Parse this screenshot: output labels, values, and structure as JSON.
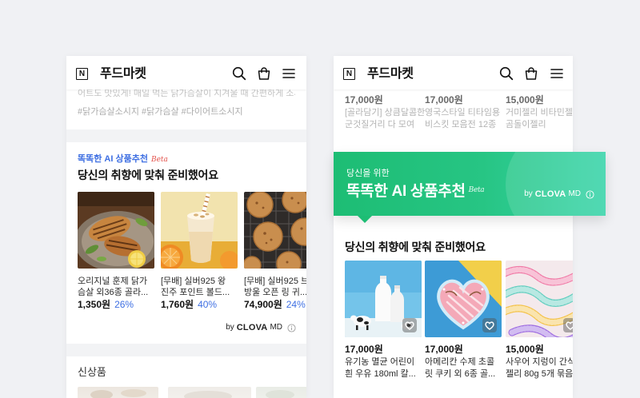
{
  "colors": {
    "page_background": "#f0f1f4",
    "ai_blue": "#3e6fe2",
    "beta_red": "#e3524b",
    "banner_green_start": "#1dbd74",
    "banner_green_end": "#38d4a9"
  },
  "left_screen": {
    "header": {
      "logo": "N",
      "title": "푸드마켓",
      "icons": [
        "search-icon",
        "shopping-bag-icon",
        "menu-icon"
      ]
    },
    "previous_product": {
      "description": "어트도 맛있게! 매일 먹는 닭가슴살이 지겨울 때 간편하게 소시",
      "hashtags": "#닭가슴살소시지 #닭가슴살 #다이어트소시지"
    },
    "recommendation": {
      "eyebrow": "똑똑한 AI 상품추천",
      "beta": "Beta",
      "title": "당신의 취향에 맞춰 준비했어요",
      "products": [
        {
          "image": "grilled-chicken-photo",
          "name_lines": [
            "오리지널 훈제 닭가",
            "슴살 외36종 골라..."
          ],
          "price": "1,350원",
          "discount": "26%"
        },
        {
          "image": "orange-smoothie-photo",
          "name_lines": [
            "[무배] 실버925 왕",
            "진주 포인트 볼드..."
          ],
          "price": "1,760원",
          "discount": "40%"
        },
        {
          "image": "cookies-photo",
          "name_lines": [
            "[무배] 실버925 브",
            "방울 오픈 링 귀..."
          ],
          "price": "74,900원",
          "discount": "24%"
        }
      ],
      "credit": {
        "by": "by",
        "brand": "CLOVA",
        "suffix": "MD",
        "icon": "info-icon"
      }
    },
    "new_arrivals": {
      "title": "신상품"
    }
  },
  "right_screen": {
    "header": {
      "logo": "N",
      "title": "푸드마켓",
      "icons": [
        "search-icon",
        "shopping-bag-icon",
        "menu-icon"
      ]
    },
    "previous_row": [
      {
        "price": "17,000원",
        "name_lines": [
          "[골라담기] 상큼달콤한",
          "군것질거리 다 모여"
        ]
      },
      {
        "price": "17,000원",
        "name_lines": [
          "영국스타일 티타임용",
          "비스킷 모음전 12종"
        ]
      },
      {
        "price": "15,000원",
        "name_lines": [
          "거미젤리 비타민젤리",
          "곰돌이젤리"
        ]
      }
    ],
    "banner": {
      "kicker": "당신을 위한",
      "title": "똑똑한 AI 상품추천",
      "beta": "Beta",
      "credit": {
        "by": "by",
        "brand": "CLOVA",
        "suffix": "MD",
        "icon": "info-icon"
      }
    },
    "recommendation": {
      "title": "당신의 취향에 맞춰 준비했어요",
      "products": [
        {
          "image": "milk-bottles-photo",
          "price": "17,000원",
          "name_lines": [
            "유기농 멸균 어린이",
            "흰 우유 180ml 칼..."
          ],
          "wish_icon": "heart-outline-icon"
        },
        {
          "image": "heart-cookie-photo",
          "price": "17,000원",
          "name_lines": [
            "아메리칸 수제 초콜",
            "릿 쿠키 외 6종 골..."
          ],
          "wish_icon": "heart-outline-icon"
        },
        {
          "image": "gummy-worms-photo",
          "price": "15,000원",
          "name_lines": [
            "사우어 지렁이 간식",
            "젤리 80g 5개 묶음"
          ],
          "wish_icon": "heart-outline-icon"
        }
      ]
    }
  }
}
